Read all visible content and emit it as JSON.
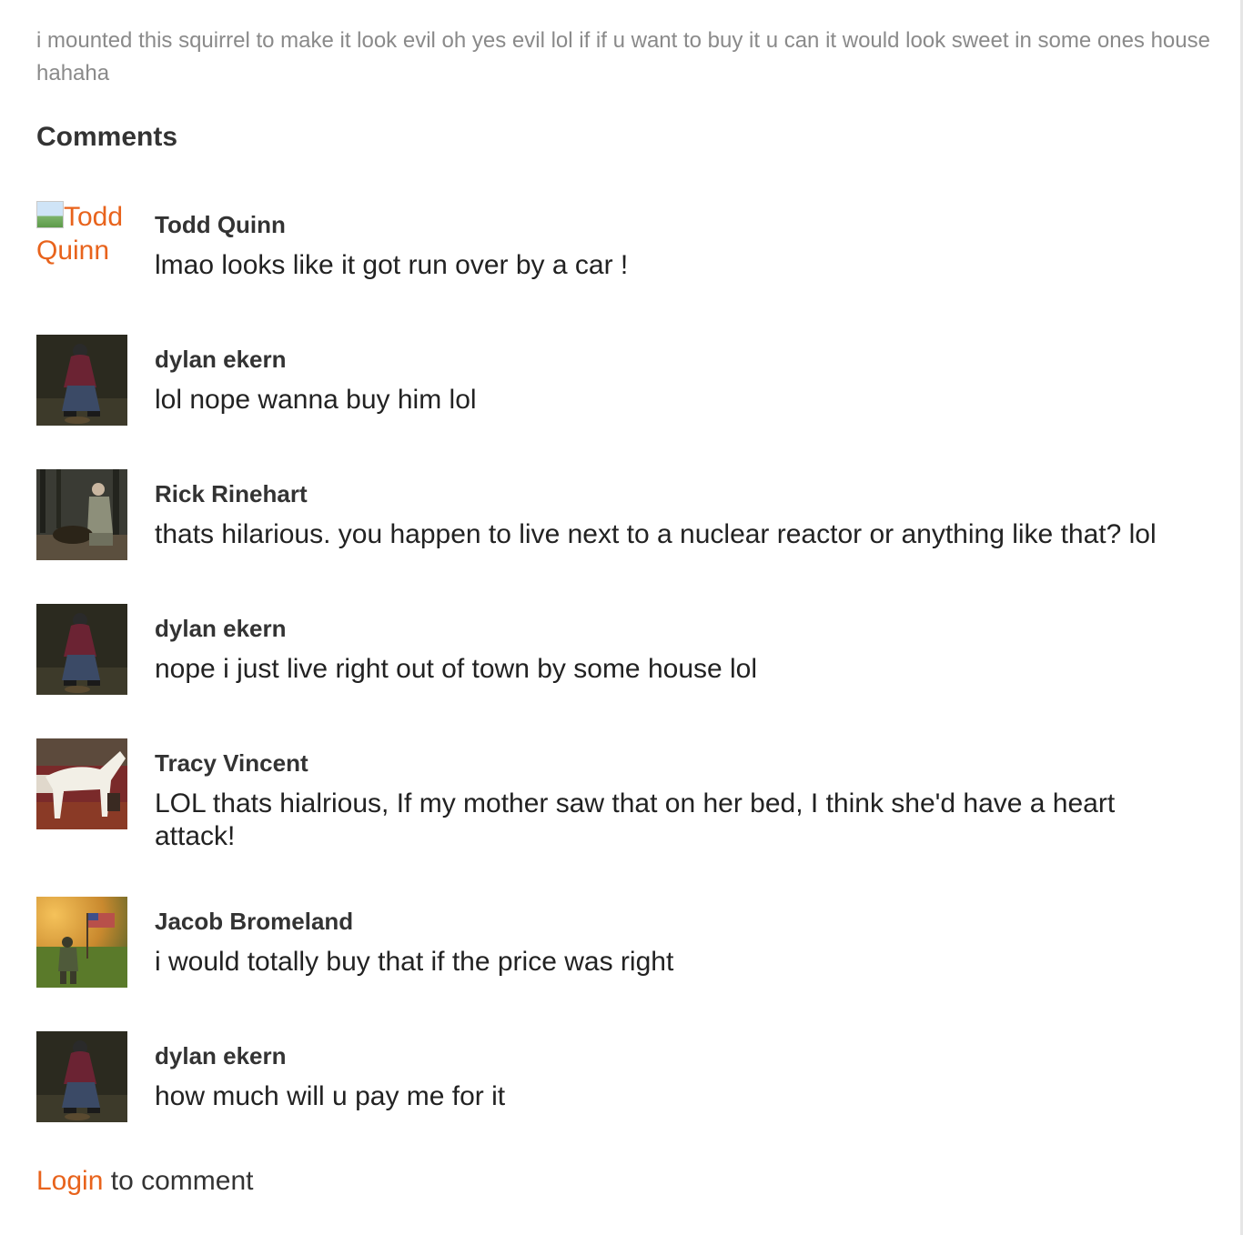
{
  "post": {
    "description": "i mounted this squirrel to make it look evil oh yes evil lol if if u want to buy it u can it would look sweet in some ones house hahaha"
  },
  "comments_section": {
    "heading": "Comments",
    "comments": [
      {
        "author": "Todd Quinn",
        "avatar_alt": "Todd Quinn",
        "text": "lmao looks like it got run over by a car !",
        "avatar": "broken-image-icon"
      },
      {
        "author": "dylan ekern",
        "text": "lol nope wanna buy him lol",
        "avatar": "user-photo-dylan"
      },
      {
        "author": "Rick Rinehart",
        "text": "thats hilarious. you happen to live next to a nuclear reactor or anything like that? lol",
        "avatar": "user-photo-rick"
      },
      {
        "author": "dylan ekern",
        "text": "nope i just live right out of town by some house lol",
        "avatar": "user-photo-dylan"
      },
      {
        "author": "Tracy Vincent",
        "text": "LOL thats hialrious, If my mother saw that on her bed, I think she'd have a heart attack!",
        "avatar": "user-photo-tracy"
      },
      {
        "author": "Jacob Bromeland",
        "text": "i would totally buy that if the price was right",
        "avatar": "user-photo-jacob"
      },
      {
        "author": "dylan ekern",
        "text": "how much will u pay me for it",
        "avatar": "user-photo-dylan"
      }
    ],
    "login_link": "Login",
    "login_suffix": " to comment"
  },
  "colors": {
    "accent": "#e8631c",
    "text": "#333333",
    "muted": "#8a8a8a"
  }
}
